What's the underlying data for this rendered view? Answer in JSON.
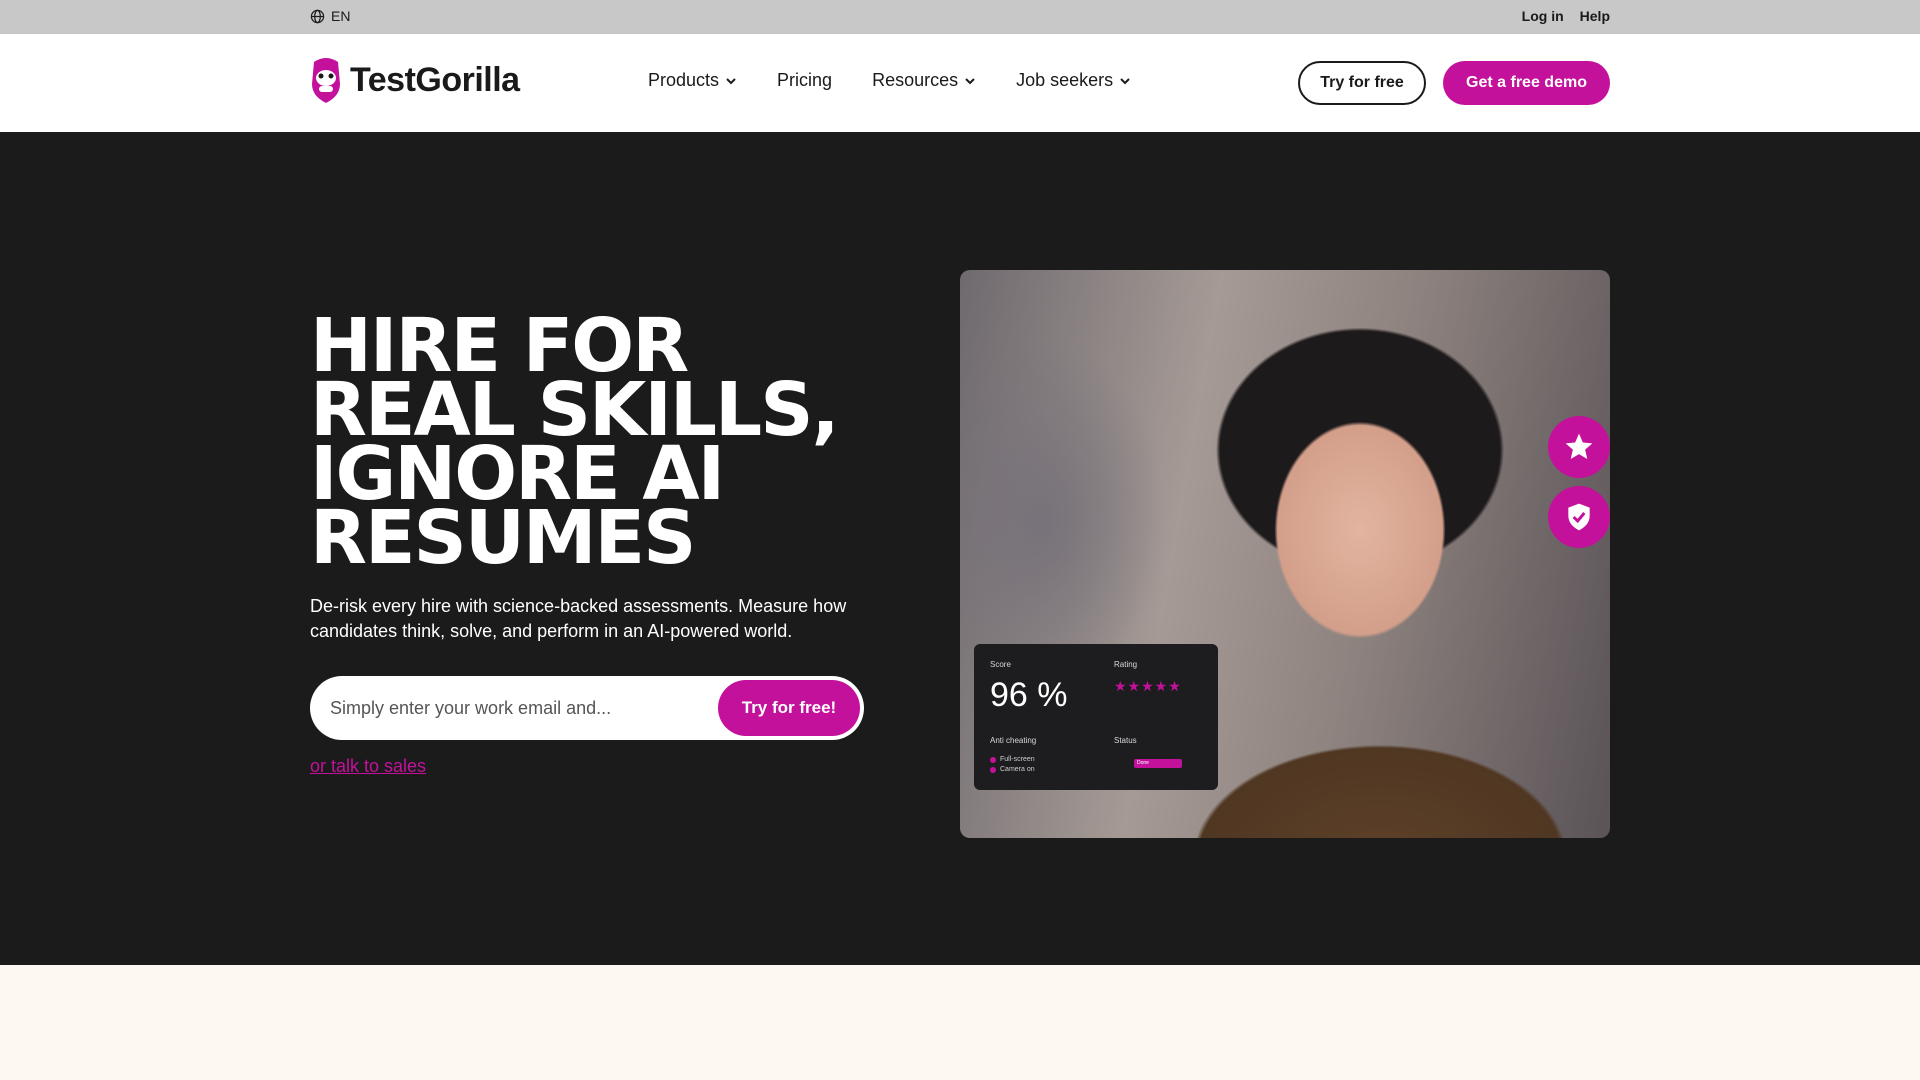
{
  "topbar": {
    "language": "EN",
    "login_label": "Log in",
    "help_label": "Help"
  },
  "nav": {
    "brand": "TestGorilla",
    "menu": [
      {
        "label": "Products",
        "has_dropdown": true
      },
      {
        "label": "Pricing",
        "has_dropdown": false
      },
      {
        "label": "Resources",
        "has_dropdown": true
      },
      {
        "label": "Job seekers",
        "has_dropdown": true
      }
    ],
    "try_free_label": "Try for free",
    "demo_label": "Get a free demo"
  },
  "hero": {
    "headline_lines": [
      "HIRE FOR",
      "REAL SKILLS,",
      "IGNORE AI",
      "RESUMES"
    ],
    "subtext": "De-risk every hire with science-backed assessments. Measure how candidates think, solve, and perform in an AI-powered world.",
    "email_placeholder": "Simply enter your work email and...",
    "email_button": "Try for free!",
    "talk_link": "or talk to sales"
  },
  "score_card": {
    "score_label": "Score",
    "score_value": "96 %",
    "rating_label": "Rating",
    "rating_stars": "★★★★★",
    "anti_cheating_label": "Anti cheating",
    "anti_cheating_items": [
      "Full-screen",
      "Camera on"
    ],
    "status_label": "Status",
    "status_value": "Done"
  },
  "badges": [
    {
      "icon": "star-icon"
    },
    {
      "icon": "shield-check-icon"
    }
  ],
  "colors": {
    "brand": "#c4119b",
    "hero_bg": "#1c1b1c",
    "topbar_bg": "#c8c8c8",
    "lower_bg": "#fdf8f1"
  }
}
